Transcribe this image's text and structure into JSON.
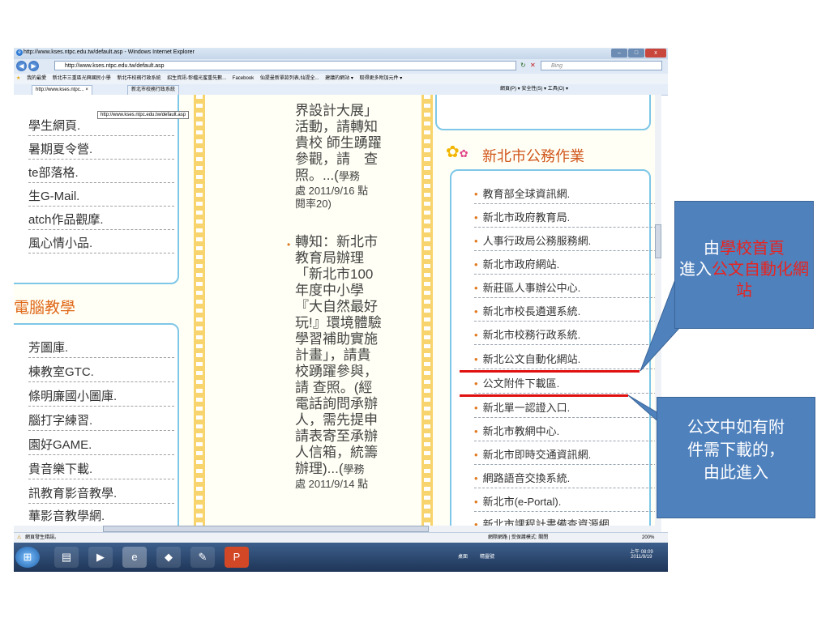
{
  "window": {
    "title": "http://www.kses.ntpc.edu.tw/default.asp - Windows Internet Explorer",
    "min": "–",
    "max": "□",
    "close": "x"
  },
  "addressbar": {
    "url": "http://www.kses.ntpc.edu.tw/default.asp",
    "search_placeholder": "Bing"
  },
  "favorites": {
    "items": [
      "我的最愛",
      "新北市三重區光興國民小學",
      "新北市校務行政系統",
      "招生資訊-彰檔光蜜重先數...",
      "Facebook",
      "仙提曼新單款列表,仙提全...",
      "建議的網站 ▾",
      "取得更多附加元件 ▾"
    ]
  },
  "tabs": {
    "tab1": "http://www.kses.ntpc... ×",
    "tab2": "新北市校務行政系統",
    "tooltip": "http://www.kses.ntpc.edu.tw/default.asp",
    "toolbar": "網頁(P) ▾  安全性(S) ▾  工具(O) ▾"
  },
  "left_column": {
    "items_top": [
      "學生網頁.",
      "暑期夏令營.",
      "te部落格.",
      "生G-Mail.",
      "atch作品觀摩.",
      "風心情小品."
    ],
    "heading": "電腦教學",
    "items_bottom": [
      "芳圖庫.",
      "棟教室GTC.",
      "條明廉國小圖庫.",
      "腦打字練習.",
      "園好GAME.",
      "貴音樂下載.",
      "訊教育影音教學.",
      "華影音教學網."
    ]
  },
  "middle_column": {
    "line1": "界設計大展」",
    "line2": "活動，請轉知",
    "line3": "貴校 師生踴躍",
    "line4": "參觀，請　查",
    "line5a": "照。...(",
    "line5b": "學務",
    "line6": "處 2011/9/16 點",
    "line7": "閱率20)",
    "bullet_text": [
      "轉知：新北市",
      "教育局辦理",
      "「新北市100",
      "年度中小學",
      "『大自然最好",
      "玩!』環境體驗",
      "學習補助實施",
      "計畫」，請貴",
      "校踴躍參與，",
      "請 查照。(經",
      "電話詢問承辦",
      "人，需先提申",
      "請表寄至承辦",
      "人信箱，統籌"
    ],
    "line_end_a": "辦理)...(",
    "line_end_b": "學務",
    "line_end2": "處 2011/9/14 點"
  },
  "right_column": {
    "heading": "新北市公務作業",
    "items": [
      "教育部全球資訊網.",
      "新北市政府教育局.",
      "人事行政局公務服務網.",
      "新北市政府網站.",
      "新莊區人事辦公中心.",
      "新北市校長遴選系統.",
      "新北市校務行政系統.",
      "新北公文自動化網站.",
      "公文附件下載區.",
      "新北單一認證入口.",
      "新北市教網中心.",
      "新北市即時交通資訊網.",
      "網路語音交換系統.",
      "新北市(e-Portal).",
      "新北市課程計畫備查資源網"
    ]
  },
  "statusbar": {
    "left": "網頁發生錯誤。",
    "center": "網際網路 | 受保護模式: 關閉",
    "zoom": "200%"
  },
  "taskbar": {
    "lang": "桌面",
    "tray_text": "精靈號",
    "time": "上午 08:09",
    "date": "2011/9/19"
  },
  "callouts": {
    "c1_pre": "由",
    "c1_red1": "學校首頁",
    "c1_mid": "進入",
    "c1_red2": "公文自動化網站",
    "c2_line1": "公文中如有附",
    "c2_line2": "件需下載的，",
    "c2_line3": "由此進入"
  },
  "colors": {
    "callout_bg": "#4f81bd",
    "callout_red": "#e8231f",
    "underline_red": "#e01010",
    "panel_border": "#7ec7e8",
    "filmstrip": "#f7d46d"
  }
}
